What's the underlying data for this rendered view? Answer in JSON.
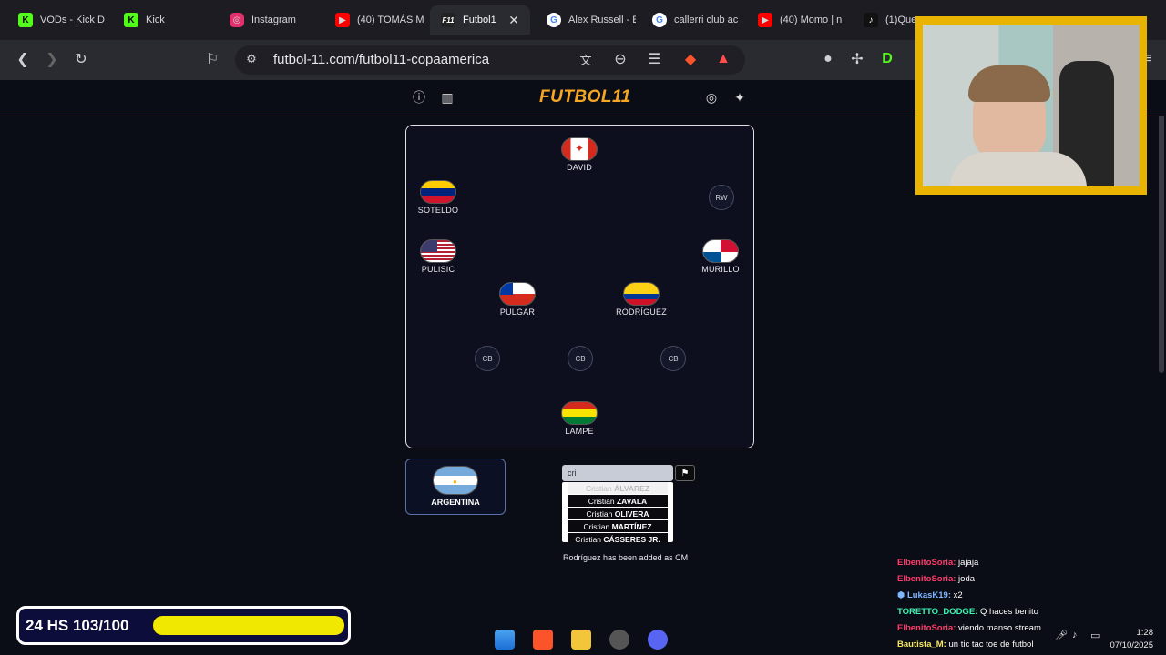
{
  "tabs": [
    {
      "label": "VODs - Kick D",
      "icon": "kick-icon",
      "color": "#53fc18"
    },
    {
      "label": "Kick",
      "icon": "kick-icon",
      "color": "#53fc18"
    },
    {
      "label": "Instagram",
      "icon": "instagram-icon",
      "color": "#e1306c"
    },
    {
      "label": "(40) TOMÁS M",
      "icon": "youtube-icon",
      "color": "#ff0000"
    },
    {
      "label": "Futbol1",
      "icon": "futbol11-icon",
      "color": "#222"
    },
    {
      "label": "Alex Russell - E",
      "icon": "google-icon",
      "color": "#4285f4"
    },
    {
      "label": "callerri club ac",
      "icon": "google-icon",
      "color": "#4285f4"
    },
    {
      "label": "(40) Momo | n",
      "icon": "youtube-icon",
      "color": "#ff0000"
    },
    {
      "label": "(1)Que",
      "icon": "tiktok-icon",
      "color": "#000"
    }
  ],
  "address_bar": {
    "url": "futbol-11.com/futbol11-copaamerica"
  },
  "site": {
    "logo": "FUTBOL11"
  },
  "pitch": {
    "players": [
      {
        "name": "DAVID",
        "flag": "canada"
      },
      {
        "name": "SOTELDO",
        "flag": "venezuela"
      },
      {
        "name": "PULISIC",
        "flag": "usa"
      },
      {
        "name": "MURILLO",
        "flag": "panama"
      },
      {
        "name": "PULGAR",
        "flag": "chile"
      },
      {
        "name": "RODRÍGUEZ",
        "flag": "colombia"
      },
      {
        "name": "LAMPE",
        "flag": "bolivia"
      }
    ],
    "empty_slots": [
      "RW",
      "CB",
      "CB",
      "CB"
    ]
  },
  "team": {
    "name": "ARGENTINA"
  },
  "search": {
    "value": "cri"
  },
  "suggestions": [
    {
      "first": "Cristian",
      "last": "ÁLVAREZ"
    },
    {
      "first": "Cristián",
      "last": "ZAVALA"
    },
    {
      "first": "Cristian",
      "last": "OLIVERA"
    },
    {
      "first": "Cristian",
      "last": "MARTÍNEZ"
    },
    {
      "first": "Cristian",
      "last": "CÁSSERES JR."
    }
  ],
  "status_message": "Rodríguez has been added as CM",
  "chat": [
    {
      "user": "ElbenitoSoria:",
      "msg": "jajaja",
      "color": "#ff3b6b"
    },
    {
      "user": "ElbenitoSoria:",
      "msg": "joda",
      "color": "#ff3b6b"
    },
    {
      "user": "LukasK19:",
      "msg": "x2",
      "color": "#7fb6ff"
    },
    {
      "user": "TORETTO_DODGE:",
      "msg": "Q haces benito",
      "color": "#3cf5b0"
    },
    {
      "user": "ElbenitoSoria:",
      "msg": "viendo manso stream",
      "color": "#ff3b6b"
    },
    {
      "user": "Bautista_M:",
      "msg": "un tic tac toe de futbol",
      "color": "#f5e663"
    }
  ],
  "counter": {
    "label": "24 HS 103/100",
    "progress": 1.0
  },
  "clock": {
    "time": "1:28",
    "date": "07/10/2025"
  }
}
